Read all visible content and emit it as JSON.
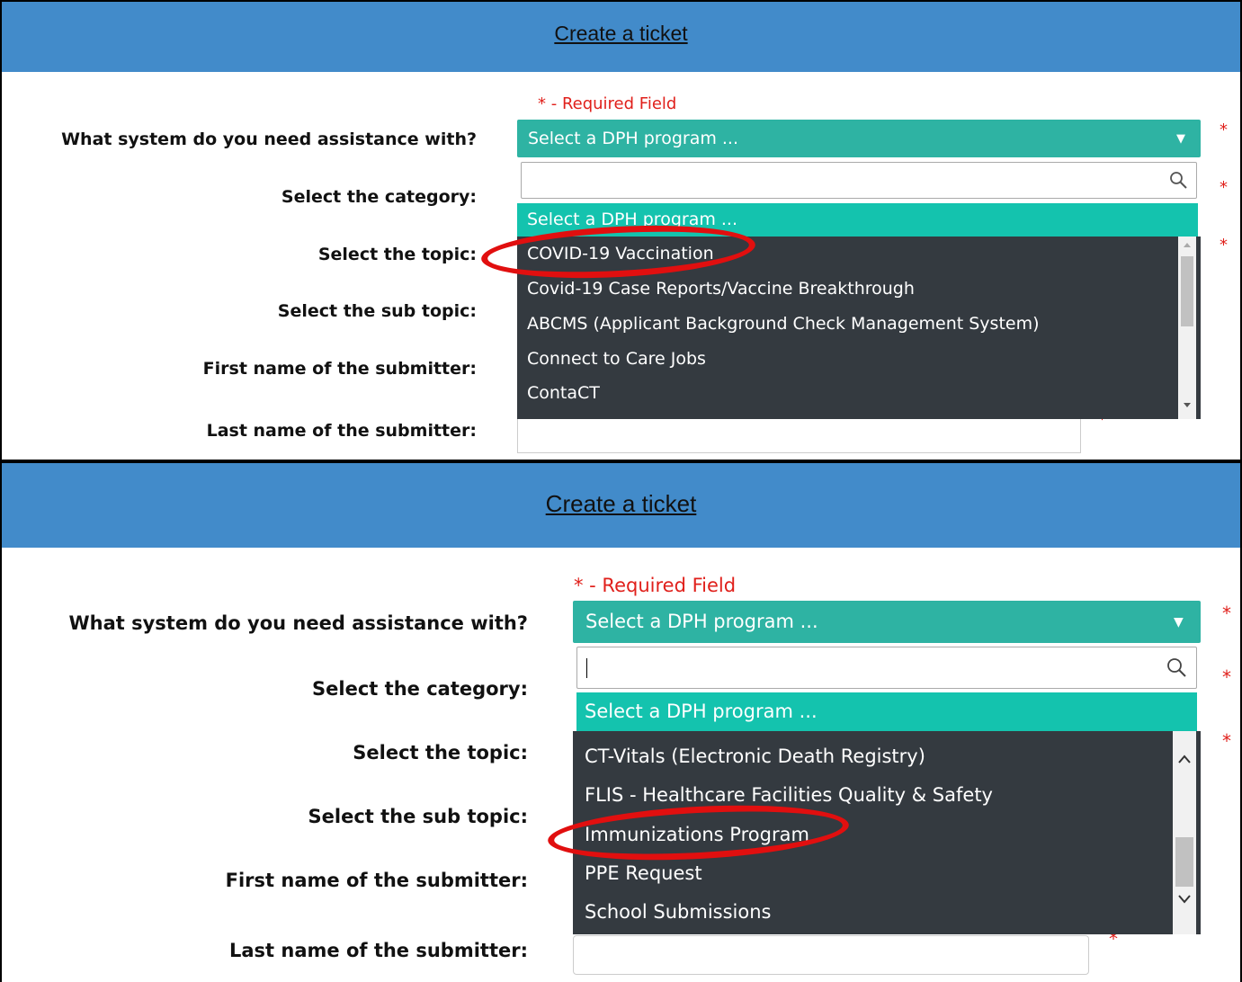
{
  "top": {
    "header_title": "Create a ticket",
    "required_note": "* - Required Field",
    "labels": [
      "What system do you need assistance with?",
      "Select the category:",
      "Select the topic:",
      "Select the sub topic:",
      "First name of the submitter:",
      "Last name of the submitter:"
    ],
    "asterisk": "*",
    "dropdown": {
      "selected": "Select a DPH program ...",
      "arrow": "▼",
      "search_value": "",
      "highlighted": "Select a DPH program ...",
      "options": [
        "COVID-19 Vaccination",
        "Covid-19 Case Reports/Vaccine Breakthrough",
        "ABCMS (Applicant Background Check Management System)",
        "Connect to Care Jobs",
        "ContaCT"
      ],
      "circled_option": "COVID-19 Vaccination"
    }
  },
  "bottom": {
    "header_title": "Create a ticket",
    "required_note": "* - Required Field",
    "labels": [
      "What system do you need assistance with?",
      "Select the category:",
      "Select the topic:",
      "Select the sub topic:",
      "First name of the submitter:",
      "Last name of the submitter:"
    ],
    "asterisk": "*",
    "dropdown": {
      "selected": "Select a DPH program ...",
      "arrow": "▼",
      "search_value": "",
      "highlighted": "Select a DPH program ...",
      "options": [
        "CT-Vitals (Electronic Death Registry)",
        "FLIS - Healthcare Facilities Quality & Safety",
        "Immunizations Program",
        "PPE Request",
        "School Submissions"
      ],
      "circled_option": "Immunizations Program"
    }
  },
  "colors": {
    "header_bg": "#428bca",
    "select_bg": "#2eb3a3",
    "highlight_bg": "#14c3ae",
    "list_bg": "#343a40",
    "required_red": "#e0201b",
    "annotation_red": "#e10f0f"
  },
  "icons": [
    "search-icon",
    "chevron-down-icon",
    "scroll-up-icon",
    "scroll-down-icon"
  ]
}
